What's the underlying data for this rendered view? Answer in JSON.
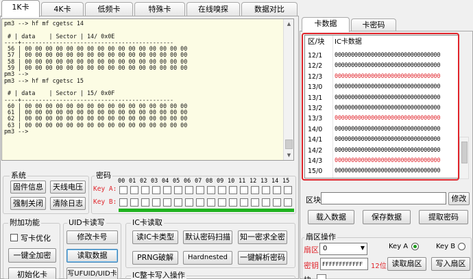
{
  "top_tabs": [
    "1K卡",
    "4K卡",
    "低频卡",
    "特殊卡",
    "在线嗅探",
    "数据对比"
  ],
  "console_text": "pm3 --> hf mf cgetsc 14\n\n # | data    | Sector | 14/ 0x0E\n----+--------------------------------------------\n 56 | 00 00 00 00 00 00 00 00 00 00 00 00 00 00 00 00\n 57 | 00 00 00 00 00 00 00 00 00 00 00 00 00 00 00 00\n 58 | 00 00 00 00 00 00 00 00 00 00 00 00 00 00 00 00\n 59 | 00 00 00 00 00 00 00 00 00 00 00 00 00 00 00 00\npm3 -->\npm3 --> hf mf cgetsc 15\n\n # | data    | Sector | 15/ 0x0F\n----+--------------------------------------------\n 60 | 00 00 00 00 00 00 00 00 00 00 00 00 00 00 00 00\n 61 | 00 00 00 00 00 00 00 00 00 00 00 00 00 00 00 00\n 62 | 00 00 00 00 00 00 00 00 00 00 00 00 00 00 00 00\n 63 | 00 00 00 00 00 00 00 00 00 00 00 00 00 00 00 00\npm3 -->",
  "system": {
    "title": "系统",
    "firmware_btn": "固件信息",
    "antenna_btn": "天线电压",
    "force_close_btn": "强制关闭",
    "clear_log_btn": "清除日志"
  },
  "keys": {
    "title": "密码",
    "key_a_label": "Key A:",
    "key_b_label": "Key B:",
    "sector_numbers": [
      "00",
      "01",
      "02",
      "03",
      "04",
      "05",
      "06",
      "07",
      "08",
      "09",
      "10",
      "11",
      "12",
      "13",
      "14",
      "15"
    ]
  },
  "extra": {
    "title": "附加功能",
    "write_opt_label": "写卡优化",
    "encrypt_all_btn": "一键全加密",
    "init_card_btn": "初始化卡"
  },
  "uid": {
    "title": "UID卡读写",
    "modify_no_btn": "修改卡号",
    "read_data_btn": "读取数据",
    "write_btn": "写UFUID/UID卡"
  },
  "ic_read": {
    "title": "IC卡读取",
    "read_type_btn": "读IC卡类型",
    "default_scan_btn": "默认密码扫描",
    "one_to_all_btn": "知一密求全密",
    "prng_btn": "PRNG破解",
    "hardnested_btn": "Hardnested",
    "one_key_parse_btn": "一键解析密码"
  },
  "ic_write": {
    "title": "IC整卡写入操作"
  },
  "right": {
    "tab_data": "卡数据",
    "tab_pwd": "卡密码",
    "col_block": "区/块",
    "col_data": "IC卡数据",
    "rows": [
      {
        "block": "12/1",
        "data": "00000000000000000000000000000000",
        "red": false
      },
      {
        "block": "12/2",
        "data": "00000000000000000000000000000000",
        "red": false
      },
      {
        "block": "12/3",
        "data": "00000000000000000000000000000000",
        "red": true
      },
      {
        "block": "13/0",
        "data": "00000000000000000000000000000000",
        "red": false
      },
      {
        "block": "13/1",
        "data": "00000000000000000000000000000000",
        "red": false
      },
      {
        "block": "13/2",
        "data": "00000000000000000000000000000000",
        "red": false
      },
      {
        "block": "13/3",
        "data": "00000000000000000000000000000000",
        "red": true
      },
      {
        "block": "14/0",
        "data": "00000000000000000000000000000000",
        "red": false
      },
      {
        "block": "14/1",
        "data": "00000000000000000000000000000000",
        "red": false
      },
      {
        "block": "14/2",
        "data": "00000000000000000000000000000000",
        "red": false
      },
      {
        "block": "14/3",
        "data": "00000000000000000000000000000000",
        "red": true
      },
      {
        "block": "15/0",
        "data": "00000000000000000000000000000000",
        "red": false
      },
      {
        "block": "15/1",
        "data": "00000000000000000000000000000000",
        "red": false
      }
    ],
    "block_label": "区块",
    "modify_btn": "修改",
    "load_btn": "载入数据",
    "save_btn": "保存数据",
    "extract_btn": "提取密码",
    "sector_op_title": "扇区操作",
    "sector_label": "扇区",
    "sector_value": "0",
    "key_a": "Key A",
    "key_b": "Key B",
    "key_label": "密钥",
    "key_value": "FFFFFFFFFFFF",
    "key_hint": "12位",
    "read_sector_btn": "读取扇区",
    "write_sector_btn": "写入扇区",
    "block_label2": "块"
  },
  "colors": {
    "red": "#e0232a",
    "green": "#1fb31f",
    "accent_blue": "#3c7fb1"
  }
}
